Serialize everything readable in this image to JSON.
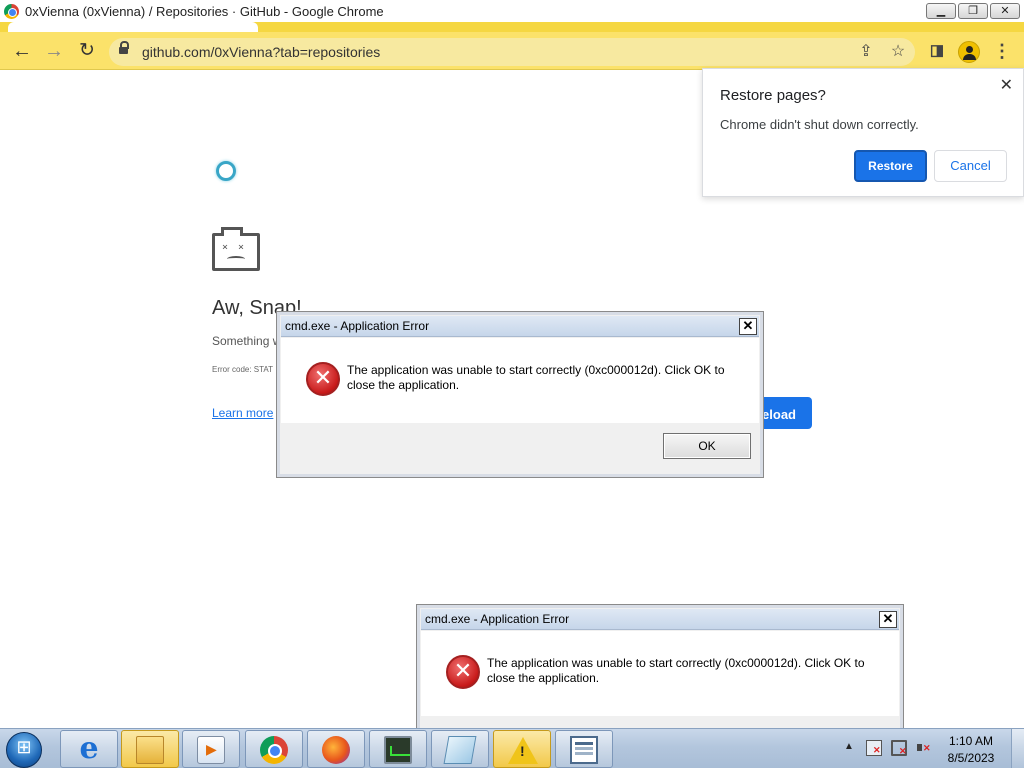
{
  "window": {
    "title": "0xVienna (0xVienna) / Repositories · GitHub - Google Chrome",
    "minimize": "▁",
    "maximize": "❐",
    "close": "✕"
  },
  "toolbar": {
    "url": "github.com/0xVienna?tab=repositories",
    "back_icon": "arrow-left",
    "forward_icon": "arrow-right",
    "reload_icon": "reload",
    "share_icon": "share",
    "bookmark_icon": "star",
    "sidebar_icon": "side-panel",
    "menu_icon": "three-dots"
  },
  "page": {
    "title": "Aw, Snap!",
    "message": "Something w",
    "error_code": "Error code: STAT",
    "learn_more": "Learn more",
    "reload_button": "eload"
  },
  "restore_bubble": {
    "title": "Restore pages?",
    "message": "Chrome didn't shut down correctly.",
    "restore_button": "Restore",
    "cancel_button": "Cancel",
    "close": "✕"
  },
  "dialogs": [
    {
      "title": "cmd.exe - Application Error",
      "message": "The application was unable to start correctly (0xc000012d). Click OK to close the application.",
      "ok_button": "OK",
      "close": "✕"
    },
    {
      "title": "cmd.exe - Application Error",
      "message": "The application was unable to start correctly (0xc000012d). Click OK to close the application.",
      "close": "✕"
    }
  ],
  "taskbar": {
    "apps": [
      "internet-explorer",
      "windows-explorer",
      "media-player",
      "google-chrome",
      "firefox",
      "task-manager",
      "notepad",
      "warning",
      "application"
    ],
    "tray_arrow": "▲",
    "clock_time": "1:10 AM",
    "clock_date": "8/5/2023"
  },
  "colors": {
    "chrome_toolbar": "#fbe26a",
    "accent_blue": "#1a73e8",
    "error_red": "#c81a1a"
  }
}
